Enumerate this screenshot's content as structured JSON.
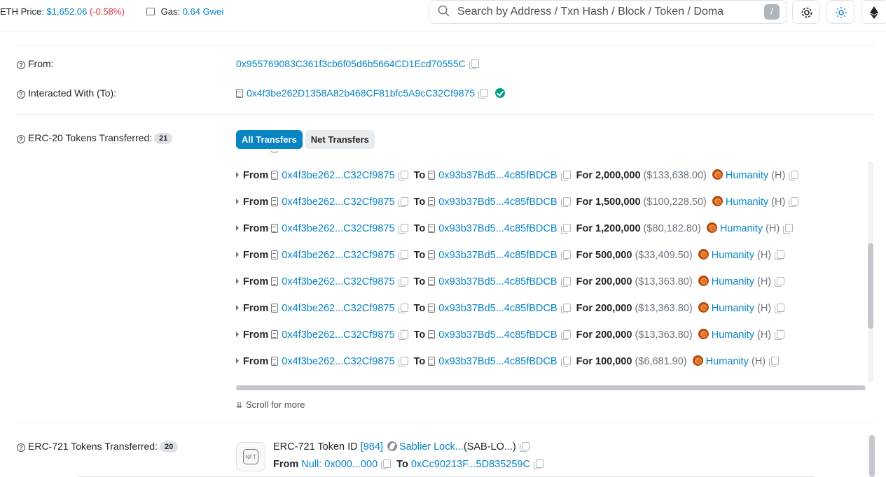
{
  "topbar": {
    "eth_price_label": "ETH Price:",
    "eth_price_value": "$1,652.06",
    "eth_price_change": "(-0.58%)",
    "gas_label": "Gas:",
    "gas_value": "0.64 Gwei",
    "search_placeholder": "Search by Address / Txn Hash / Block / Token / Doma",
    "search_shortcut": "/"
  },
  "details": {
    "from_label": "From:",
    "from_value": "0x955769083C361f3cb6f05d6b5664CD1Ecd70555C",
    "to_label": "Interacted With (To):",
    "to_value": "0x4f3be262D1358A82b468CF81bfc5A9cC32Cf9875",
    "erc20_label": "ERC-20 Tokens Transferred:",
    "erc20_count": "21",
    "erc721_label": "ERC-721 Tokens Transferred:",
    "erc721_count": "20"
  },
  "tabs": {
    "all": "All Transfers",
    "net": "Net Transfers"
  },
  "common": {
    "from_word": "From",
    "to_word": "To",
    "for_word": "For",
    "from_addr": "0x4f3be262...C32Cf9875",
    "to_addr": "0x93b37Bd5...4c85fBDCB",
    "token_name": "Humanity",
    "token_symbol": "(H)"
  },
  "transfers": [
    {
      "amount": "2,000,000",
      "usd": "($133,638.00)"
    },
    {
      "amount": "1,500,000",
      "usd": "($100,228.50)"
    },
    {
      "amount": "1,200,000",
      "usd": "($80,182.80)"
    },
    {
      "amount": "500,000",
      "usd": "($33,409.50)"
    },
    {
      "amount": "200,000",
      "usd": "($13,363.80)"
    },
    {
      "amount": "200,000",
      "usd": "($13,363.80)"
    },
    {
      "amount": "200,000",
      "usd": "($13,363.80)"
    },
    {
      "amount": "100,000",
      "usd": "($6,681.90)"
    }
  ],
  "scroll_more": "Scroll for more",
  "nft": {
    "standard": "ERC-721",
    "token_id_label": "Token ID",
    "token_id": "[984]",
    "collection": "Sablier Lock...",
    "collection_symbol": "(SAB-LO...)",
    "from_word": "From",
    "from_addr": "Null: 0x000...000",
    "to_word": "To",
    "to_addr": "0xCc90213F...5D835259C",
    "icon_text": "NFT"
  }
}
